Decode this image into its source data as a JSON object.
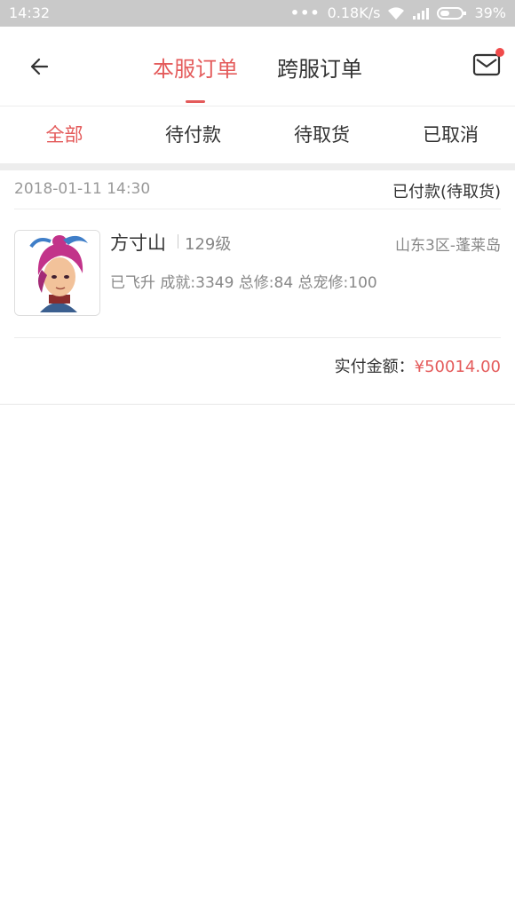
{
  "status_bar": {
    "time": "14:32",
    "network_speed": "0.18K/s",
    "battery": "39%",
    "icons": [
      "dots-icon",
      "wifi-icon",
      "signal-icon",
      "battery-icon"
    ]
  },
  "header": {
    "back_icon": "arrow-left-icon",
    "tabs": [
      {
        "label": "本服订单",
        "active": true
      },
      {
        "label": "跨服订单",
        "active": false
      }
    ],
    "mail_icon": "mail-icon",
    "has_notification": true
  },
  "filters": [
    {
      "label": "全部",
      "active": true
    },
    {
      "label": "待付款",
      "active": false
    },
    {
      "label": "待取货",
      "active": false
    },
    {
      "label": "已取消",
      "active": false
    }
  ],
  "order": {
    "time": "2018-01-11 14:30",
    "status": "已付款(待取货)",
    "name": "方寸山",
    "level": "129级",
    "server": "山东3区-蓬莱岛",
    "stats": "已飞升 成就:3349 总修:84 总宠修:100",
    "paid_label": "实付金额：",
    "paid_amount": "¥50014.00"
  },
  "colors": {
    "accent": "#e45b5b",
    "status_bar": "#c9c9c9",
    "divider": "#ededed"
  }
}
